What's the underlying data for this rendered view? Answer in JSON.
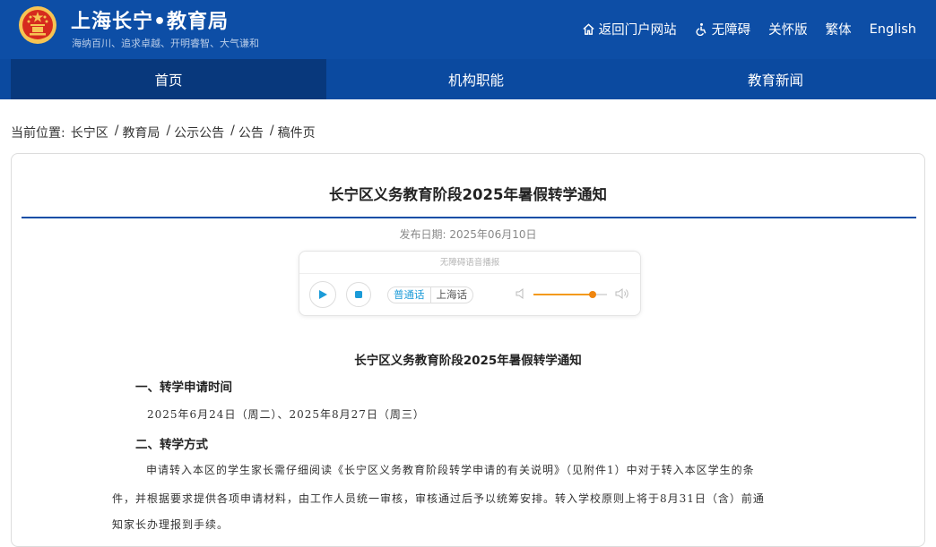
{
  "header": {
    "title": "上海长宁•教育局",
    "slogan": "海纳百川、追求卓越、开明睿智、大气谦和",
    "links": [
      {
        "label": "返回门户网站",
        "icon": "home-icon"
      },
      {
        "label": "无障碍",
        "icon": "accessibility-icon"
      },
      {
        "label": "关怀版"
      },
      {
        "label": "繁体"
      },
      {
        "label": "English"
      }
    ]
  },
  "nav": {
    "items": [
      "首页",
      "机构职能",
      "教育新闻"
    ]
  },
  "breadcrumb": {
    "prefix": "当前位置:",
    "items": [
      "长宁区",
      "教育局",
      "公示公告",
      "公告",
      "稿件页"
    ],
    "separator": "/"
  },
  "article": {
    "title": "长宁区义务教育阶段2025年暑假转学通知",
    "date": "发布日期: 2025年06月10日",
    "player": {
      "header": "无障碍语音播报",
      "lang_options": [
        "普通话",
        "上海话"
      ],
      "volume": 0.8
    },
    "body_title": "长宁区义务教育阶段2025年暑假转学通知",
    "sections": [
      {
        "heading": "一、转学申请时间",
        "lines": [
          "2025年6月24日（周二）、2025年8月27日（周三）"
        ]
      },
      {
        "heading": "二、转学方式",
        "lines": [
          "申请转入本区的学生家长需仔细阅读《长宁区义务教育阶段转学申请的有关说明》（见附件1）中对于转入本区学生的条",
          "件，并根据要求提供各项申请材料，由工作人员统一审核，审核通过后予以统筹安排。转入学校原则上将于8月31日（含）前通",
          "知家长办理报到手续。"
        ]
      }
    ]
  },
  "colors": {
    "brand_blue": "#0d4ea6",
    "nav_active": "#08387c",
    "accent_orange": "#f0860f",
    "accent_cyan": "#1b9bd8"
  }
}
